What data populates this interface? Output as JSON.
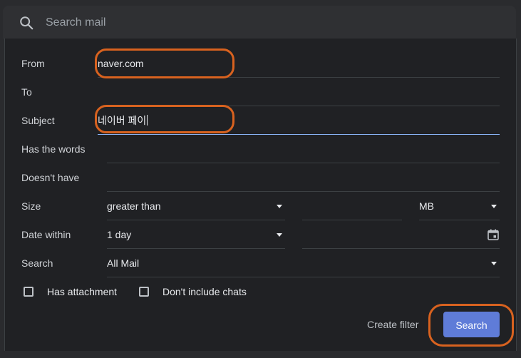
{
  "search": {
    "placeholder": "Search mail"
  },
  "form": {
    "from": {
      "label": "From",
      "value": "naver.com"
    },
    "to": {
      "label": "To",
      "value": ""
    },
    "subject": {
      "label": "Subject",
      "value": "네이버 페이"
    },
    "has_words": {
      "label": "Has the words",
      "value": ""
    },
    "doesnt_have": {
      "label": "Doesn't have",
      "value": ""
    },
    "size": {
      "label": "Size",
      "operator": "greater than",
      "value": "",
      "unit": "MB"
    },
    "date_within": {
      "label": "Date within",
      "value": "1 day",
      "date": ""
    },
    "search_in": {
      "label": "Search",
      "value": "All Mail"
    },
    "has_attachment": {
      "label": "Has attachment",
      "checked": false
    },
    "no_chats": {
      "label": "Don't include chats",
      "checked": false
    }
  },
  "actions": {
    "create_filter": "Create filter",
    "search": "Search"
  },
  "colors": {
    "highlight": "#d8621f",
    "primary_button": "#5f7cd8",
    "focus_underline": "#8ab4f8"
  },
  "icons": {
    "search": "search-icon",
    "calendar": "calendar-icon",
    "dropdown": "dropdown-caret-icon"
  }
}
